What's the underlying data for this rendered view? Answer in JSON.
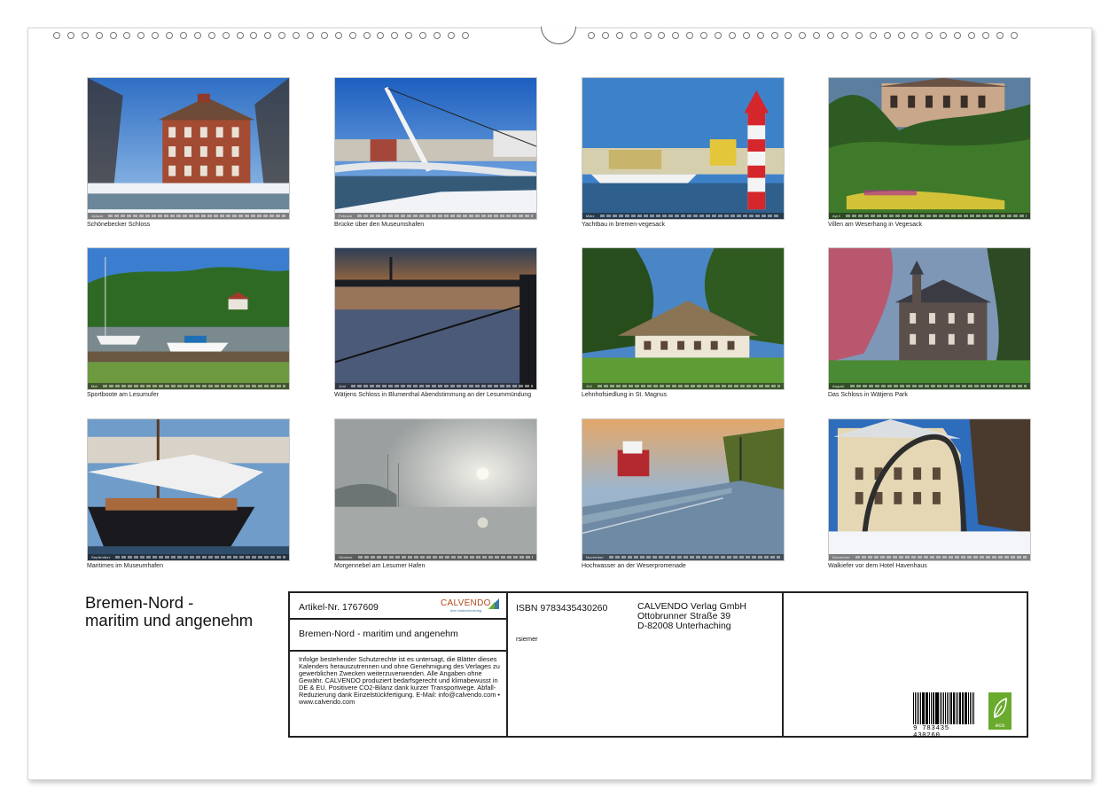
{
  "calendar": {
    "title_line1": "Bremen-Nord -",
    "title_line2": "maritim und angenehm"
  },
  "photos": [
    {
      "caption": "Schönebecker Schloss",
      "month": "Januar",
      "scene": "manor-winter"
    },
    {
      "caption": "Brücke über den Museumshafen",
      "month": "Februar",
      "scene": "bridge-harbor"
    },
    {
      "caption": "Yachtbau in bremen-vegesack",
      "month": "März",
      "scene": "lighthouse-yacht"
    },
    {
      "caption": "Villen am Weserhang in Vegesack",
      "month": "April",
      "scene": "villa-garden"
    },
    {
      "caption": "Sportboote am Lesumufer",
      "month": "Mai",
      "scene": "boats-river"
    },
    {
      "caption": "Wätjens Schloss in Blumenthal Abendstimmung an der Lesummündung",
      "month": "Juni",
      "scene": "sunset-river"
    },
    {
      "caption": "Lehnhofsiedlung in St. Magnus",
      "month": "Juli",
      "scene": "thatched-house"
    },
    {
      "caption": "Das Schloss in Wätjens Park",
      "month": "August",
      "scene": "castle-park"
    },
    {
      "caption": "Maritimes im Museumhafen",
      "month": "September",
      "scene": "sailing-ship"
    },
    {
      "caption": "Morgennebel am Lesumer Hafen",
      "month": "Oktober",
      "scene": "fog-harbor"
    },
    {
      "caption": "Hochwasser an der Weserpromenade",
      "month": "November",
      "scene": "flood-promenade"
    },
    {
      "caption": "Walkiefer vor dem Hotel Havenhaus",
      "month": "Dezember",
      "scene": "whale-jaw"
    }
  ],
  "info": {
    "article": "Artikel-Nr. 1767609",
    "logo_text": "CALVENDO",
    "logo_sub": "dein kalenderverlag",
    "product_title": "Bremen-Nord - maritim und angenehm",
    "legal": "Infolge bestehender Schutzrechte ist es untersagt, die Blätter dieses Kalenders herauszutrennen und ohne Genehmigung des Verlages zu gewerblichen Zwecken weiterzuverwenden. Alle Angaben ohne Gewähr. CALVENDO produziert bedarfsgerecht und klimabewusst in DE & EU. Positivere CO2-Bilanz dank kurzer Transportwege. Abfall-Reduzierung dank Einzelstückfertigung. E-Mail: info@calvendo.com • www.calvendo.com",
    "isbn": "ISBN 9783435430260",
    "author": "rsiemer",
    "publisher_name": "CALVENDO Verlag GmbH",
    "publisher_street": "Ottobrunner Straße 39",
    "publisher_city": "D-82008 Unterhaching",
    "barcode_digits": "9   783435   430260",
    "eco_label": "eco"
  },
  "colors": {
    "calvendo_orange": "#b34a1e",
    "calvendo_blue": "#3a7aa6",
    "eco_green": "#6aaa2c"
  }
}
